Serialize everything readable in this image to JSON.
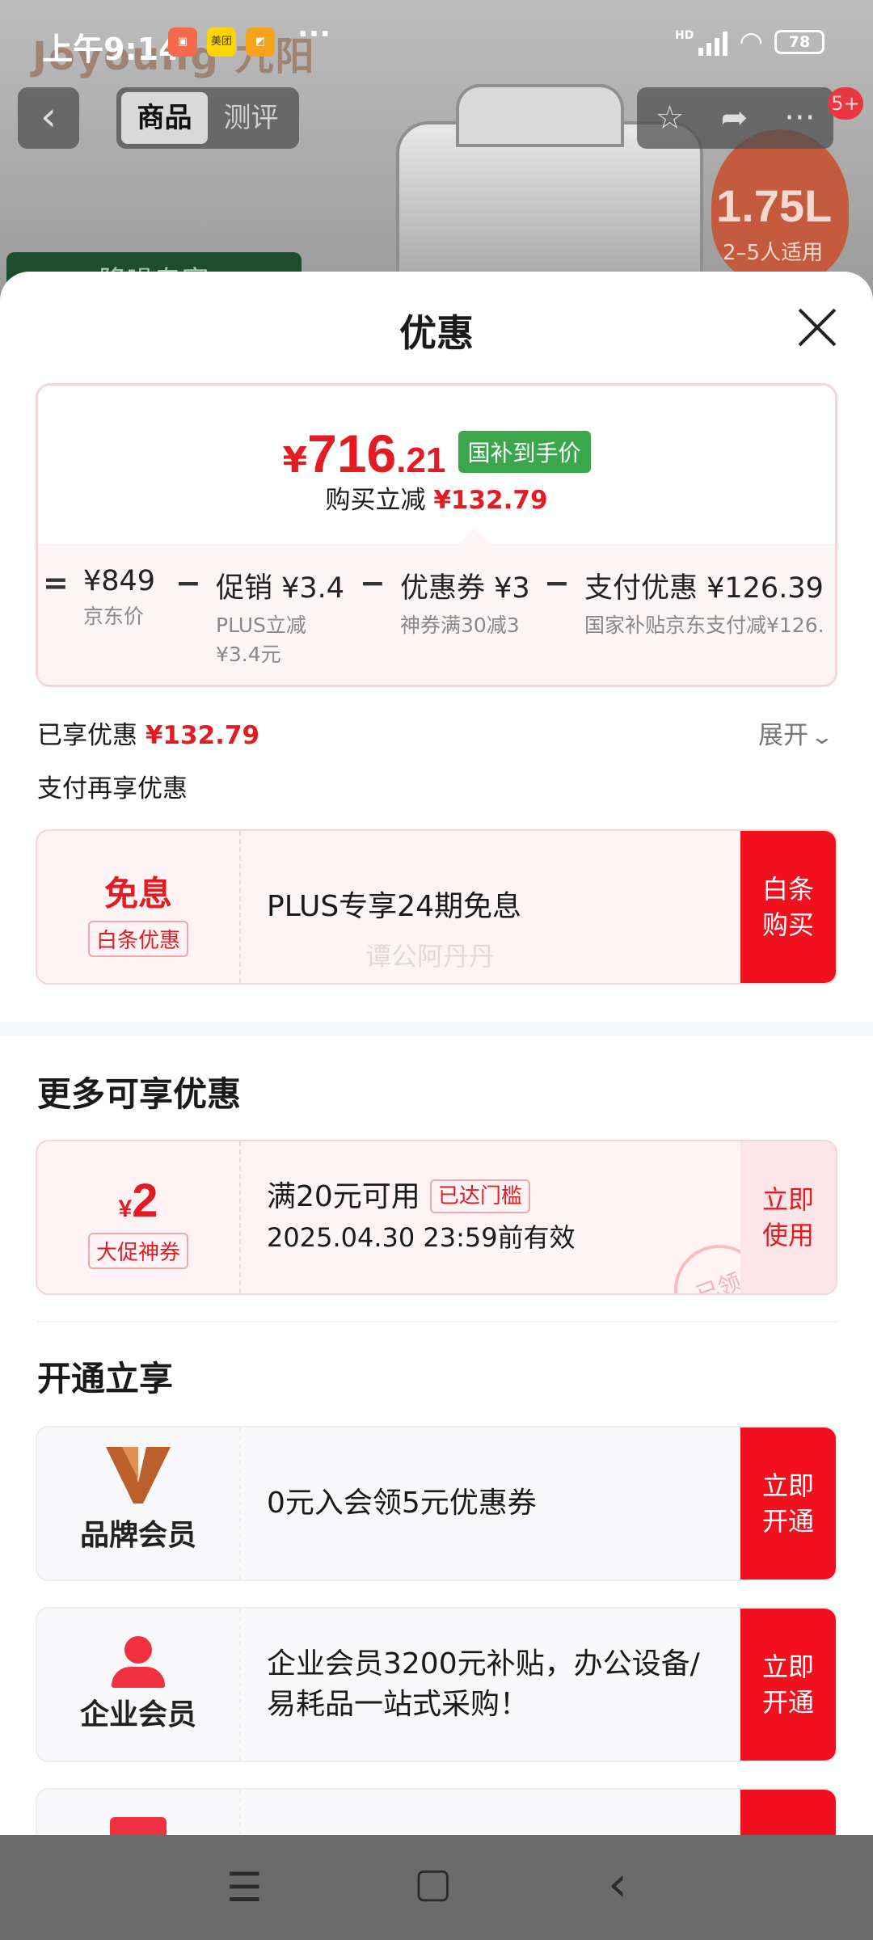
{
  "status_bar": {
    "time": "上午9:14",
    "battery": "78",
    "network": "HD"
  },
  "background": {
    "brand": "Joyoung 九阳",
    "badge_volume": "1.75L",
    "badge_people": "2–5人适用",
    "green_banner": "降噪专家"
  },
  "top_nav": {
    "tabs": [
      {
        "label": "商品"
      },
      {
        "label": "测评"
      }
    ],
    "notification_count": "5+"
  },
  "sheet": {
    "title": "优惠",
    "price": {
      "currency": "¥",
      "integer": "716",
      "decimal": ".21",
      "tag": "国补到手价",
      "save_label": "购买立减",
      "save_amount": "¥132.79"
    },
    "breakdown": [
      {
        "op": "=",
        "main": "¥849",
        "sub": "京东价"
      },
      {
        "op": "−",
        "main": "促销 ¥3.4",
        "sub": "PLUS立减",
        "sub2": "¥3.4元"
      },
      {
        "op": "−",
        "main": "优惠券 ¥3",
        "sub": "神券满30减3"
      },
      {
        "op": "−",
        "main": "支付优惠 ¥126.39",
        "sub": "国家补贴京东支付减¥126."
      }
    ],
    "enjoyed_label": "已享优惠",
    "enjoyed_amount": "¥132.79",
    "expand_label": "展开",
    "pay_more_title": "支付再享优惠",
    "baitiao": {
      "head": "免息",
      "label": "白条优惠",
      "desc": "PLUS专享24期免息",
      "button": "白条 购买",
      "watermark": "谭公阿丹丹"
    },
    "more_title": "更多可享优惠",
    "coupon": {
      "currency": "¥",
      "amount": "2",
      "label": "大促神券",
      "condition": "满20元可用",
      "status_tag": "已达门槛",
      "validity": "2025.04.30 23:59前有效",
      "button": "立即 使用",
      "stamp": "已领"
    },
    "open_title": "开通立享",
    "members": [
      {
        "name": "品牌会员",
        "desc": "0元入会领5元优惠券",
        "button": "立即 开通"
      },
      {
        "name": "企业会员",
        "desc": "企业会员3200元补贴，办公设备/易耗品一站式采购！",
        "button": "立即 开通"
      }
    ]
  },
  "colors": {
    "accent_red": "#f2101f",
    "price_red": "#e31b23",
    "green_tag": "#3aa84a"
  }
}
